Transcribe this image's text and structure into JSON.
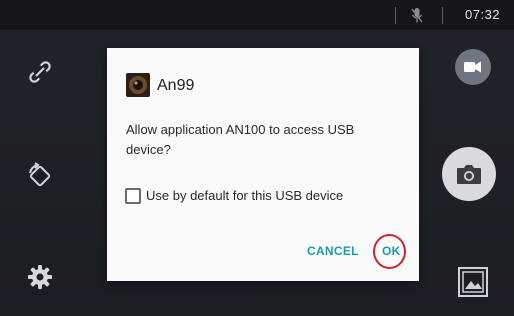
{
  "statusbar": {
    "time": "07:32",
    "mic_icon": "mic-off-icon"
  },
  "left_controls": [
    {
      "name": "link-icon"
    },
    {
      "name": "rotate-icon"
    },
    {
      "name": "gear-icon"
    }
  ],
  "right_controls": {
    "video_icon": "video-camera-icon",
    "camera_icon": "camera-icon",
    "gallery_icon": "gallery-icon"
  },
  "dialog": {
    "app_name": "An99",
    "message": "Allow application AN100 to access USB device?",
    "checkbox_label": "Use by default for this USB device",
    "checkbox_checked": false,
    "cancel_label": "CANCEL",
    "ok_label": "OK",
    "accent_color": "#1e9aa8",
    "highlight_color": "#d2232b"
  }
}
